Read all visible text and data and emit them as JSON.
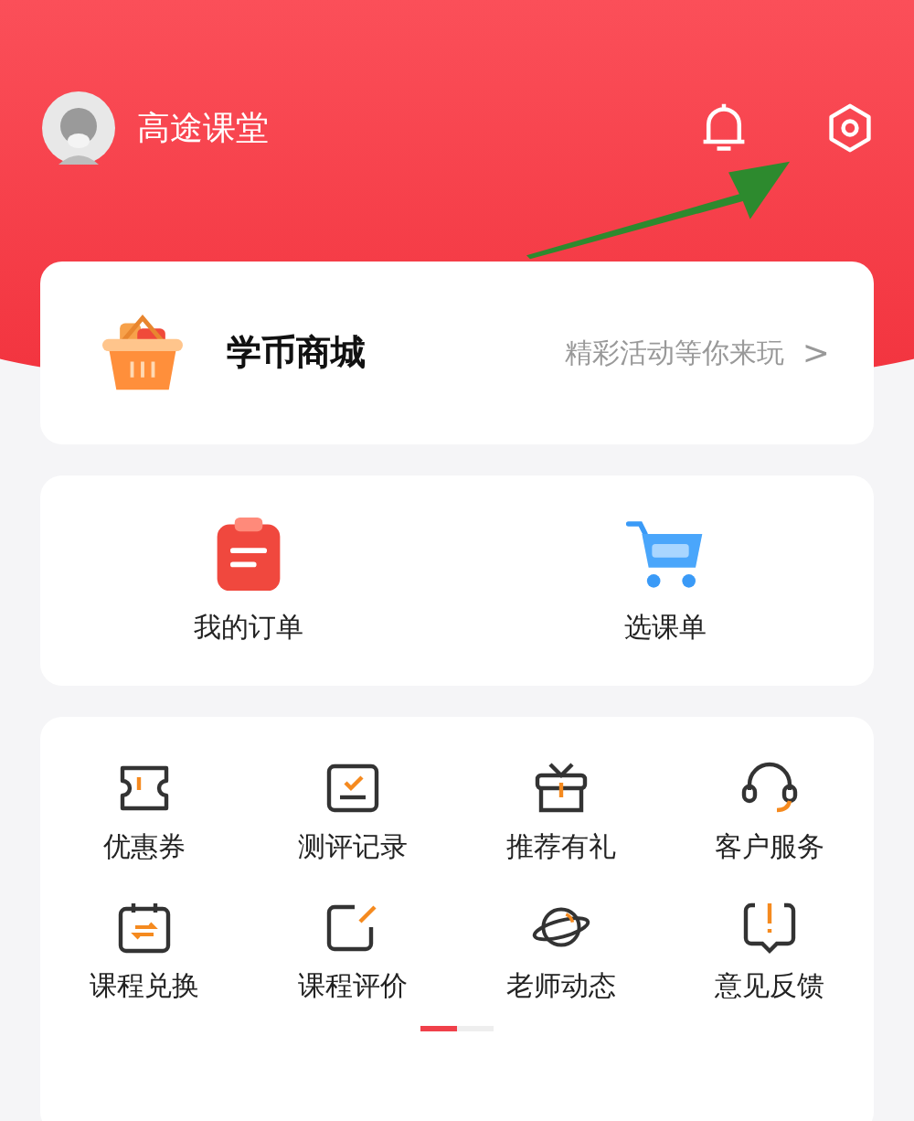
{
  "header": {
    "username": "高途课堂"
  },
  "mall": {
    "title": "学币商城",
    "subtitle": "精彩活动等你来玩",
    "chevron": ">"
  },
  "shortcuts": [
    {
      "kind": "orders",
      "label": "我的订单"
    },
    {
      "kind": "cart",
      "label": "选课单"
    }
  ],
  "services": [
    {
      "kind": "coupon",
      "label": "优惠券"
    },
    {
      "kind": "assessment",
      "label": "测评记录"
    },
    {
      "kind": "gift",
      "label": "推荐有礼"
    },
    {
      "kind": "support",
      "label": "客户服务"
    },
    {
      "kind": "exchange",
      "label": "课程兑换"
    },
    {
      "kind": "review",
      "label": "课程评价"
    },
    {
      "kind": "planet",
      "label": "老师动态"
    },
    {
      "kind": "feedback",
      "label": "意见反馈"
    }
  ],
  "pager": [
    {
      "selected": true
    },
    {
      "selected": false
    }
  ]
}
